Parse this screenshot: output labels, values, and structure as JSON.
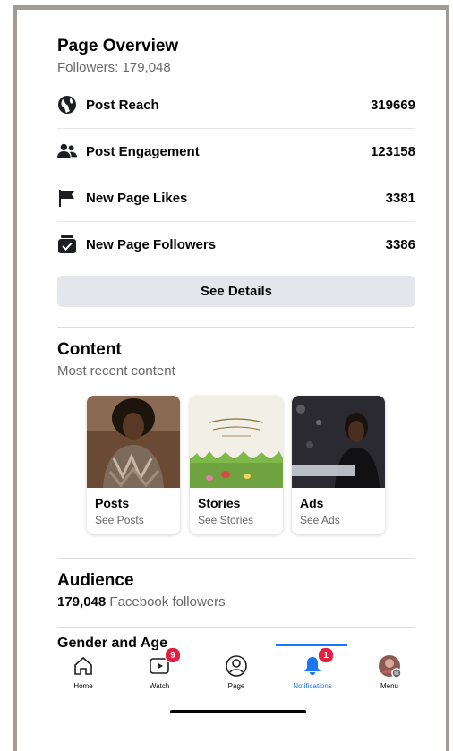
{
  "overview": {
    "title": "Page Overview",
    "followers_line": "Followers: 179,048",
    "metrics": [
      {
        "icon": "globe-icon",
        "label": "Post Reach",
        "value": "319669"
      },
      {
        "icon": "people-icon",
        "label": "Post Engagement",
        "value": "123158"
      },
      {
        "icon": "flag-icon",
        "label": "New Page Likes",
        "value": "3381"
      },
      {
        "icon": "followers-check-icon",
        "label": "New Page Followers",
        "value": "3386"
      }
    ],
    "details_button": "See Details"
  },
  "content": {
    "title": "Content",
    "subtitle": "Most recent content",
    "cards": [
      {
        "title": "Posts",
        "subtitle": "See Posts"
      },
      {
        "title": "Stories",
        "subtitle": "See Stories"
      },
      {
        "title": "Ads",
        "subtitle": "See Ads"
      }
    ]
  },
  "audience": {
    "title": "Audience",
    "count": "179,048",
    "count_suffix": " Facebook followers",
    "gender_age": "Gender and Age"
  },
  "nav": {
    "items": [
      {
        "label": "Home",
        "icon": "home-icon"
      },
      {
        "label": "Watch",
        "icon": "watch-icon",
        "badge": "9"
      },
      {
        "label": "Page",
        "icon": "page-profile-icon"
      },
      {
        "label": "Notifications",
        "icon": "bell-icon",
        "badge": "1"
      },
      {
        "label": "Menu",
        "icon": "avatar-menu-icon"
      }
    ]
  },
  "colors": {
    "accent": "#1877f2",
    "badge": "#e41e3f",
    "button_bg": "#e4e6eb"
  }
}
